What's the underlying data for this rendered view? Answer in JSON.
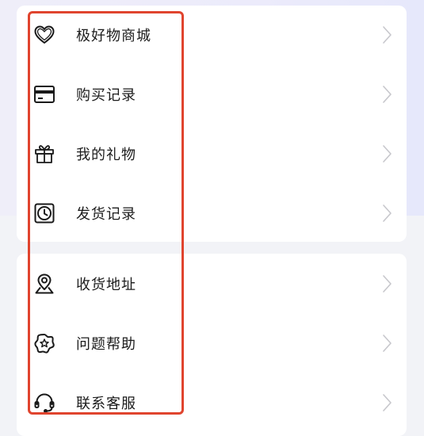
{
  "colors": {
    "highlight": "#e0442e",
    "text": "#1c1c1c",
    "chevron": "#c7c7cc",
    "icon": "#1a1a1a"
  },
  "menu_group_1": {
    "items": [
      {
        "label": "极好物商城",
        "icon": "heart-icon"
      },
      {
        "label": "购买记录",
        "icon": "credit-card-icon"
      },
      {
        "label": "我的礼物",
        "icon": "gift-icon"
      },
      {
        "label": "发货记录",
        "icon": "clock-icon"
      }
    ]
  },
  "menu_group_2": {
    "items": [
      {
        "label": "收货地址",
        "icon": "location-pin-icon"
      },
      {
        "label": "问题帮助",
        "icon": "star-badge-icon"
      },
      {
        "label": "联系客服",
        "icon": "headset-icon"
      }
    ]
  }
}
